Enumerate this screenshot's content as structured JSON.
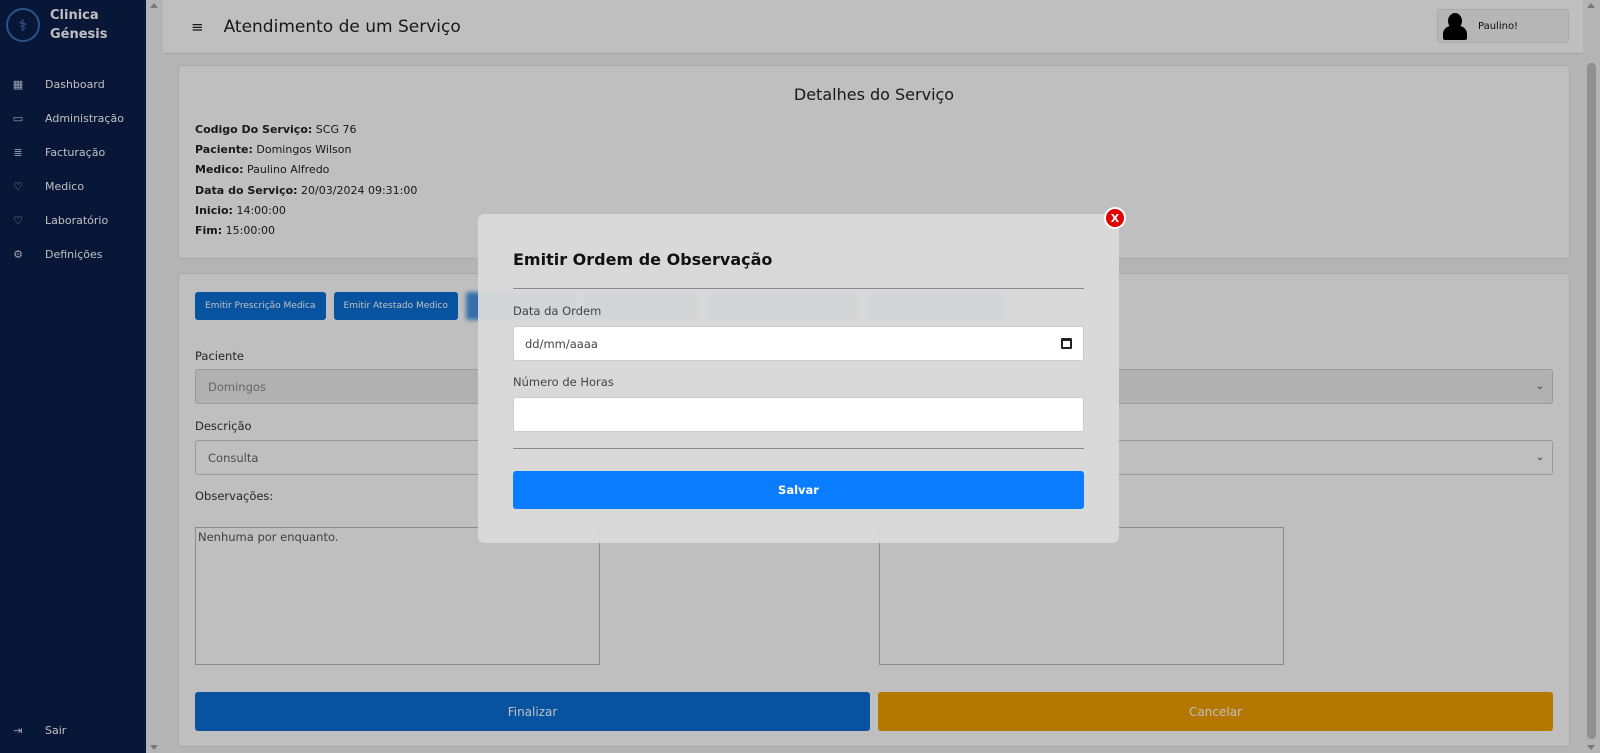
{
  "brand": {
    "name_line1": "Clinica",
    "name_line2": "Génesis",
    "logo_icon": "caduceus-icon"
  },
  "sidebar": {
    "items": [
      {
        "label": "Dashboard",
        "icon": "grid-icon"
      },
      {
        "label": "Administração",
        "icon": "box-icon"
      },
      {
        "label": "Facturação",
        "icon": "database-icon"
      },
      {
        "label": "Medico",
        "icon": "heart-icon"
      },
      {
        "label": "Laboratório",
        "icon": "heart-icon"
      },
      {
        "label": "Definições",
        "icon": "gear-icon"
      }
    ],
    "logout": {
      "label": "Sair",
      "icon": "logout-icon"
    }
  },
  "header": {
    "title": "Atendimento de um Serviço",
    "user": "Paulino!"
  },
  "details": {
    "title": "Detalhes do Serviço",
    "rows": [
      {
        "k": "Codigo Do Serviço:",
        "v": " SCG 76"
      },
      {
        "k": "Paciente:",
        "v": " Domingos Wilson"
      },
      {
        "k": "Medico:",
        "v": " Paulino Alfredo"
      },
      {
        "k": "Data do Serviço:",
        "v": " 20/03/2024 09:31:00"
      },
      {
        "k": "Inicio:",
        "v": " 14:00:00"
      },
      {
        "k": "Fim:",
        "v": " 15:00:00"
      }
    ]
  },
  "actions": {
    "btn1": "Emitir Prescrição Medica",
    "btn2": "Emitir Atestado Medico"
  },
  "form": {
    "paciente_label": "Paciente",
    "paciente_value": "Domingos",
    "descricao_label": "Descrição",
    "descricao_value": "Consulta",
    "observacoes_label": "Observações:",
    "observacoes_value": "Nenhuma por enquanto.",
    "finalizar": "Finalizar",
    "cancelar": "Cancelar"
  },
  "modal": {
    "close": "X",
    "title": "Emitir Ordem de Observação",
    "date_label": "Data da Ordem",
    "date_placeholder": "dd/mm/aaaa",
    "hours_label": "Número de Horas",
    "hours_value": "",
    "save": "Salvar"
  },
  "colors": {
    "sidebar": "#0b1f4b",
    "primary": "#0a6fd6",
    "warning": "#f0a000",
    "danger": "#e00000"
  }
}
